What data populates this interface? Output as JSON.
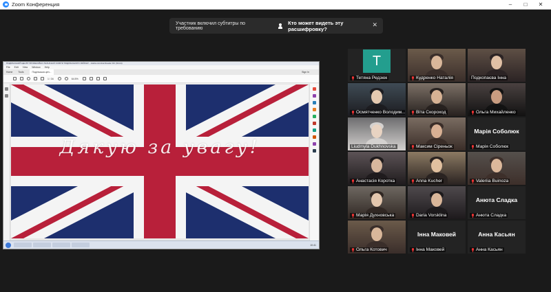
{
  "window": {
    "title": "Zoom Конференция",
    "controls": [
      "–",
      "□",
      "✕"
    ]
  },
  "caption_bar": {
    "notice": "Участник включил субтитры по требованию",
    "link": "Кто может видеть эту расшифровку?",
    "close": "✕"
  },
  "shared_screen": {
    "app_title": "ПОДІЛЬСЬКИЙ ЦЕНТР ПРОФЕСІЙНО-ТЕХНІЧНОЇ ОСВІТИ ПОДІЛЬСЬКОГО РАЙОНУ - Adobe Acrobat Reader DC (64-bit)",
    "menu": [
      "File",
      "Edit",
      "View",
      "Window",
      "Help"
    ],
    "tabs": [
      "Home",
      "Tools",
      "Подільська цен..."
    ],
    "signin": "Sign In",
    "zoom_level": "64.5%",
    "page_indicator": "1 / 34",
    "slide_text": "Дякую за увагу!",
    "flag_colors": {
      "blue": "#1d2f6e",
      "white": "#f4f4f4",
      "red": "#b8203a"
    },
    "taskbar_time": "10:41"
  },
  "gallery": {
    "accent": "#c8d43a",
    "tiles": [
      {
        "name": "Тетяна Редзюк",
        "avatar": "T",
        "type": "letter",
        "muted": true
      },
      {
        "name": "Кудренко Наталія",
        "type": "video",
        "muted": true
      },
      {
        "name": "Подкопаєва Інна",
        "type": "video",
        "muted": false
      },
      {
        "name": "Осмятченко Володим...",
        "type": "video",
        "muted": true
      },
      {
        "name": "Віта Скороход",
        "type": "video",
        "muted": true
      },
      {
        "name": "Ольга Михайленко",
        "type": "video",
        "muted": true
      },
      {
        "name": "Liudmyla Dukhnovska",
        "type": "video",
        "muted": false,
        "active": true
      },
      {
        "name": "Максим Сіреньок",
        "type": "video",
        "muted": true
      },
      {
        "name": "Марія Соболюк",
        "big": "Марія Соболюк",
        "type": "name",
        "muted": true
      },
      {
        "name": "Анастасія Коротка",
        "type": "video",
        "muted": true
      },
      {
        "name": "Anna Kucher",
        "type": "video",
        "muted": true
      },
      {
        "name": "Valeriia Buinoza",
        "type": "video",
        "muted": true
      },
      {
        "name": "Марія Духновська",
        "type": "video",
        "muted": true
      },
      {
        "name": "Daria Vorsklina",
        "type": "video",
        "muted": true
      },
      {
        "name": "Анюта Сладка",
        "big": "Анюта Сладка",
        "type": "name",
        "muted": true
      },
      {
        "name": "Ольга Котович",
        "type": "video",
        "muted": true
      },
      {
        "name": "Інна Маковей",
        "big": "Інна Маковей",
        "type": "name",
        "muted": true
      },
      {
        "name": "Анна Касьян",
        "big": "Анна Касьян",
        "type": "name",
        "muted": true
      }
    ]
  }
}
